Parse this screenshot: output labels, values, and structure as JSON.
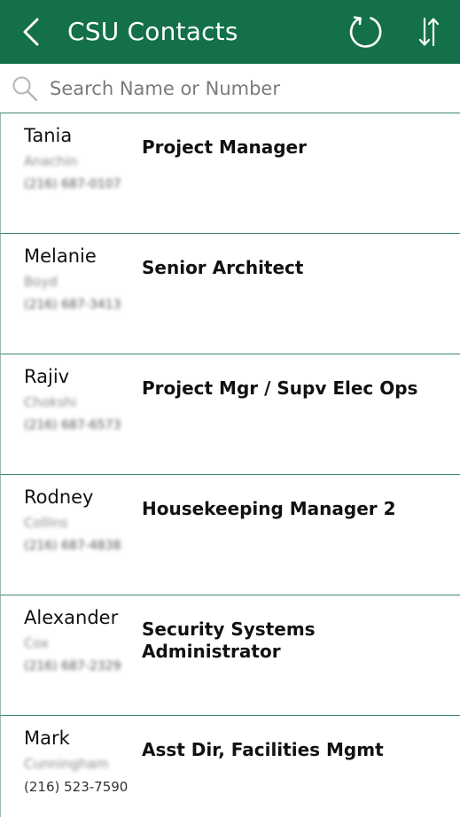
{
  "header": {
    "title": "CSU Contacts"
  },
  "search": {
    "placeholder": "Search Name or Number",
    "value": ""
  },
  "contacts": [
    {
      "first": "Tania",
      "last": "Anachin",
      "phone": "(216) 687-0107",
      "title": "Project Manager"
    },
    {
      "first": "Melanie",
      "last": "Boyd",
      "phone": "(216) 687-3413",
      "title": "Senior Architect"
    },
    {
      "first": "Rajiv",
      "last": "Chokshi",
      "phone": "(216) 687-6573",
      "title": "Project Mgr / Supv Elec Ops"
    },
    {
      "first": "Rodney",
      "last": "Collins",
      "phone": "(216) 687-4838",
      "title": "Housekeeping Manager 2"
    },
    {
      "first": "Alexander",
      "last": "Cox",
      "phone": "(216) 687-2329",
      "title": "Security Systems Administrator"
    },
    {
      "first": "Mark",
      "last": "Cunningham",
      "phone": "(216) 523-7590",
      "title": "Asst Dir, Facilities Mgmt"
    }
  ],
  "colors": {
    "header_bg": "#137048",
    "divider": "#3d8a67"
  }
}
